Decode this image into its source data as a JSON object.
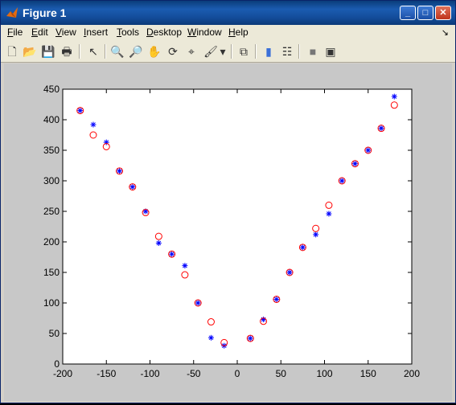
{
  "window": {
    "title": "Figure 1"
  },
  "titlebar_buttons": {
    "minimize": "_",
    "maximize": "□",
    "close": "✕"
  },
  "menu": [
    {
      "label": "File",
      "u": "F",
      "rest": "ile"
    },
    {
      "label": "Edit",
      "u": "E",
      "rest": "dit"
    },
    {
      "label": "View",
      "u": "V",
      "rest": "iew"
    },
    {
      "label": "Insert",
      "u": "I",
      "rest": "nsert"
    },
    {
      "label": "Tools",
      "u": "T",
      "rest": "ools"
    },
    {
      "label": "Desktop",
      "u": "D",
      "rest": "esktop"
    },
    {
      "label": "Window",
      "u": "W",
      "rest": "indow"
    },
    {
      "label": "Help",
      "u": "H",
      "rest": "elp"
    }
  ],
  "menu_arrow": "↘",
  "toolbar": {
    "tools": [
      {
        "name": "new-figure-icon",
        "glyph": "🗋"
      },
      {
        "name": "open-file-icon",
        "glyph": "📂"
      },
      {
        "name": "save-icon",
        "glyph": "💾"
      },
      {
        "name": "print-icon",
        "glyph": "🖶"
      },
      {
        "name": "edit-plot-arrow-icon",
        "glyph": "↖"
      },
      {
        "name": "zoom-in-icon",
        "glyph": "🔍"
      },
      {
        "name": "zoom-out-icon",
        "glyph": "🔎"
      },
      {
        "name": "pan-hand-icon",
        "glyph": "✋"
      },
      {
        "name": "rotate-3d-icon",
        "glyph": "⟳"
      },
      {
        "name": "data-cursor-icon",
        "glyph": "⌖"
      },
      {
        "name": "brush-icon",
        "glyph": "🖌"
      },
      {
        "name": "brush-dropdown-icon",
        "glyph": "▾"
      },
      {
        "name": "link-plot-icon",
        "glyph": "⧉"
      },
      {
        "name": "colorbar-icon",
        "glyph": "▮"
      },
      {
        "name": "legend-icon",
        "glyph": "☷"
      },
      {
        "name": "hide-plot-tools-icon",
        "glyph": "■"
      },
      {
        "name": "show-plot-tools-icon",
        "glyph": "▣"
      }
    ]
  },
  "colors": {
    "series_star": "#0000ff",
    "series_circle": "#ff0000",
    "figure_bg": "#c8c8c8",
    "axes_bg": "#ffffff"
  },
  "chart_data": {
    "type": "scatter",
    "title": "",
    "xlabel": "",
    "ylabel": "",
    "xlim": [
      -200,
      200
    ],
    "ylim": [
      0,
      450
    ],
    "xticks": [
      -200,
      -150,
      -100,
      -50,
      0,
      50,
      100,
      150,
      200
    ],
    "yticks": [
      0,
      50,
      100,
      150,
      200,
      250,
      300,
      350,
      400,
      450
    ],
    "grid": false,
    "series": [
      {
        "marker": "star",
        "color": "#0000ff",
        "x": [
          -180,
          -165,
          -150,
          -135,
          -120,
          -105,
          -90,
          -75,
          -60,
          -45,
          -30,
          -15,
          15,
          30,
          45,
          60,
          75,
          90,
          105,
          120,
          135,
          150,
          165,
          180
        ],
        "y": [
          415,
          392,
          363,
          316,
          290,
          250,
          198,
          180,
          161,
          100,
          43,
          30,
          42,
          73,
          106,
          150,
          191,
          212,
          246,
          300,
          328,
          350,
          386,
          438
        ]
      },
      {
        "marker": "circle",
        "color": "#ff0000",
        "x": [
          -180,
          -165,
          -150,
          -135,
          -120,
          -105,
          -90,
          -75,
          -60,
          -45,
          -30,
          -15,
          15,
          30,
          45,
          60,
          75,
          90,
          105,
          120,
          135,
          150,
          165,
          180
        ],
        "y": [
          415,
          375,
          356,
          316,
          290,
          248,
          209,
          180,
          146,
          100,
          69,
          35,
          42,
          70,
          106,
          150,
          191,
          222,
          260,
          300,
          328,
          350,
          386,
          424
        ]
      }
    ]
  }
}
